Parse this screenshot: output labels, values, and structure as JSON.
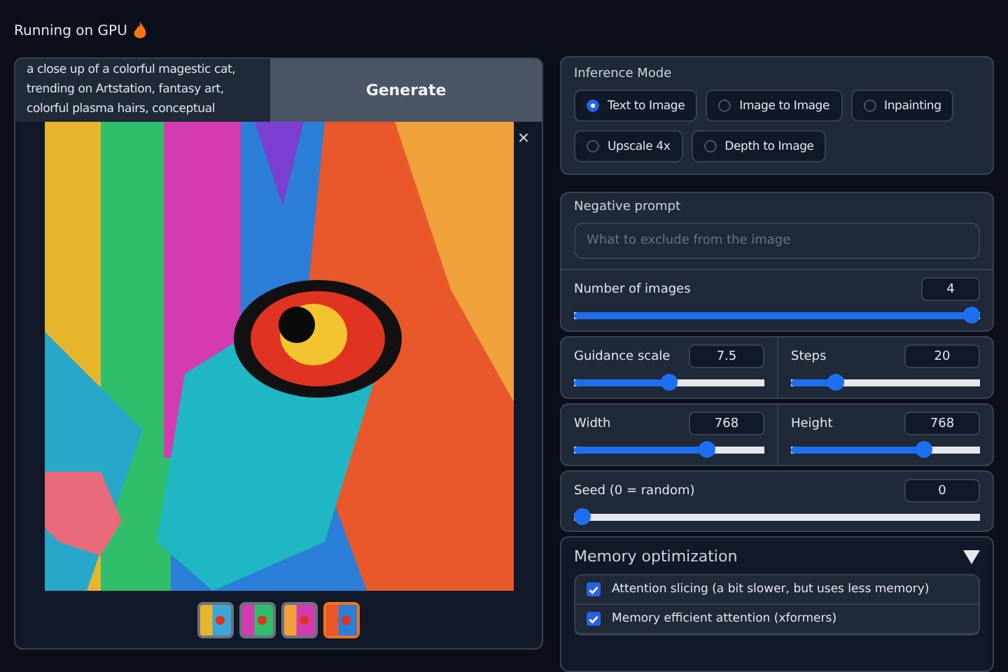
{
  "header": {
    "status": "Running on GPU"
  },
  "prompt": {
    "value": "a close up of a colorful magestic cat, trending on Artstation, fantasy art, colorful plasma hairs, conceptual"
  },
  "generate_button": "Generate",
  "gallery": {
    "close": "×",
    "thumbnails": [
      {
        "selected": false
      },
      {
        "selected": false
      },
      {
        "selected": false
      },
      {
        "selected": true
      }
    ]
  },
  "inference_mode": {
    "label": "Inference Mode",
    "options": [
      {
        "label": "Text to Image",
        "selected": true
      },
      {
        "label": "Image to Image",
        "selected": false
      },
      {
        "label": "Inpainting",
        "selected": false
      },
      {
        "label": "Upscale 4x",
        "selected": false
      },
      {
        "label": "Depth to Image",
        "selected": false
      }
    ]
  },
  "negative_prompt": {
    "label": "Negative prompt",
    "placeholder": "What to exclude from the image"
  },
  "sliders": [
    {
      "label": "Number of images",
      "value": "4",
      "level": 1.0
    },
    {
      "label": "Guidance scale",
      "value": "7.5",
      "level": 0.5
    },
    {
      "label": "Steps",
      "value": "20",
      "level": 0.21
    },
    {
      "label": "Width",
      "value": "768",
      "level": 0.72
    },
    {
      "label": "Height",
      "value": "768",
      "level": 0.72
    },
    {
      "label": "Seed (0 = random)",
      "value": "0",
      "level": 0.0
    }
  ],
  "memory": {
    "title": "Memory optimization",
    "expanded": true,
    "options": [
      {
        "label": "Attention slicing (a bit slower, but uses less memory)",
        "checked": true
      },
      {
        "label": "Memory efficient attention (xformers)",
        "checked": true
      }
    ]
  }
}
